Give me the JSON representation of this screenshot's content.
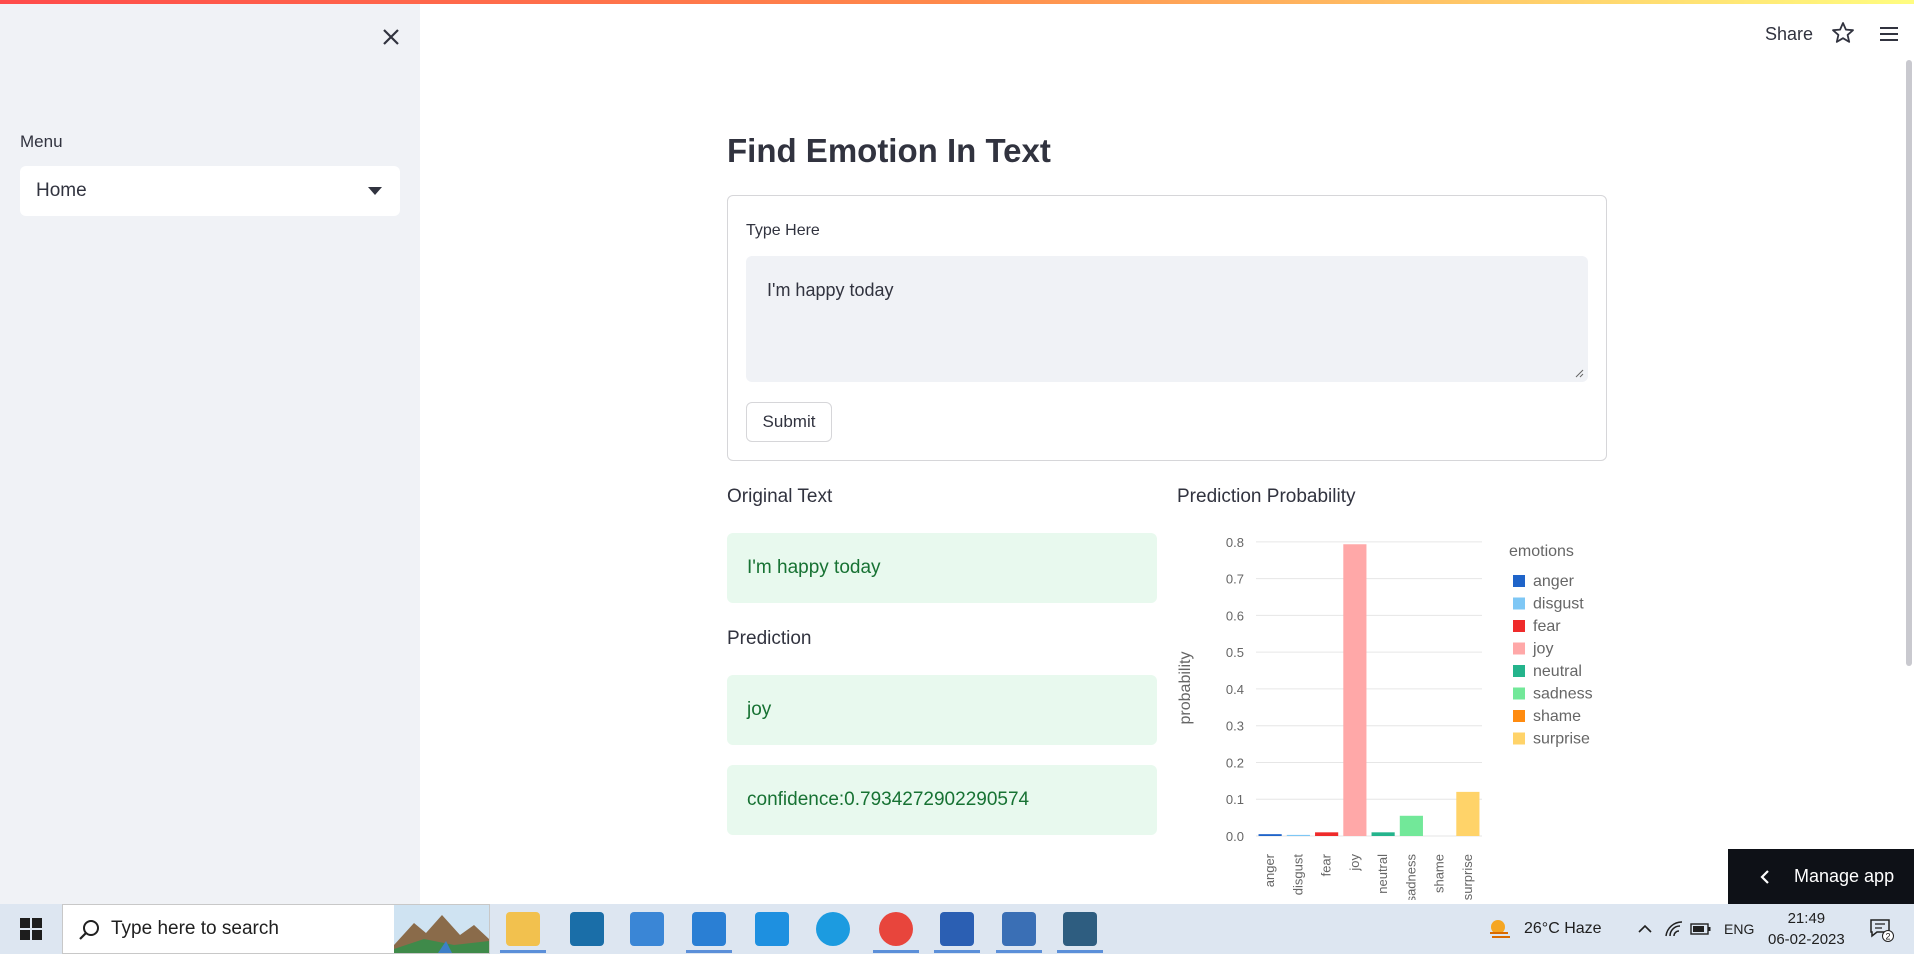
{
  "sidebar": {
    "menu_label": "Menu",
    "selected": "Home"
  },
  "header": {
    "share_label": "Share"
  },
  "main": {
    "title": "Find Emotion In Text",
    "form_label": "Type Here",
    "input_value": "I'm happy today",
    "submit_label": "Submit",
    "original_heading": "Original Text",
    "original_text": "I'm happy today",
    "prediction_heading": "Prediction",
    "prediction": "joy",
    "confidence": "confidence:0.7934272902290574",
    "chart_heading": "Prediction Probability"
  },
  "chart_data": {
    "type": "bar",
    "categories": [
      "anger",
      "disgust",
      "fear",
      "joy",
      "neutral",
      "sadness",
      "shame",
      "surprise"
    ],
    "values": [
      0.005,
      0.003,
      0.01,
      0.7934272902290574,
      0.01,
      0.055,
      0.0,
      0.12
    ],
    "colors": [
      "#1f64c9",
      "#7ec7f5",
      "#ef2b2b",
      "#ffa8a8",
      "#24b48c",
      "#72e899",
      "#ff8b0f",
      "#ffd369"
    ],
    "ylabel": "probability",
    "xlabel": "",
    "legend_title": "emotions",
    "legend_position": "right",
    "yticks": [
      0.0,
      0.1,
      0.2,
      0.3,
      0.4,
      0.5,
      0.6,
      0.7,
      0.8
    ],
    "ylim": [
      0,
      0.8
    ],
    "grid": true
  },
  "manage_app": "Manage app",
  "taskbar": {
    "search_placeholder": "Type here to search",
    "weather": "26°C  Haze",
    "language": "ENG",
    "time": "21:49",
    "date": "06-02-2023",
    "notification_count": "2"
  }
}
